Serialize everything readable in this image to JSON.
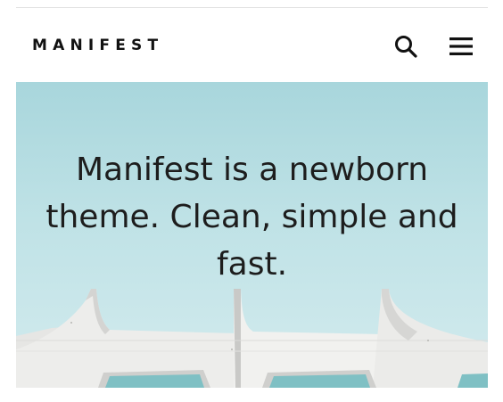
{
  "header": {
    "logo_text": "MANIFEST",
    "search_icon": "search-icon",
    "menu_icon": "hamburger-menu-icon"
  },
  "hero": {
    "heading": "Manifest is a newborn theme. Clean, simple and fast."
  },
  "colors": {
    "sky_top": "#a8d6dc",
    "sky_bottom": "#d3ebee",
    "text": "#1d1d1d",
    "building": "#eeeeec",
    "window_glass": "#7fc0c4"
  }
}
